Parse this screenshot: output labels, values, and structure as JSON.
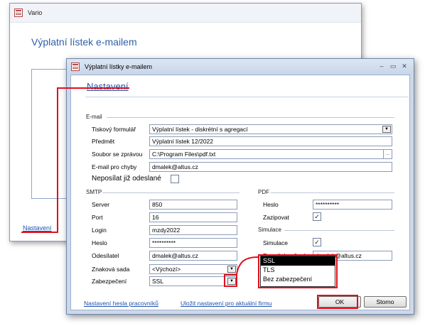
{
  "back_window": {
    "title": "Vario",
    "heading": "Výplatní lístek e-mailem",
    "link": "Nastavení"
  },
  "dialog": {
    "title": "Výplatní lístky e-mailem",
    "heading": "Nastavení",
    "email_section": "E-mail",
    "tiskovy_formular_label": "Tiskový formulář",
    "tiskovy_formular_value": "Výplatní lístek - diskrétní s agregací",
    "predmet_label": "Předmět",
    "predmet_value": "Výplatní lístek 12/2022",
    "soubor_label": "Soubor se zprávou",
    "soubor_value": "C:\\Program Files\\pdf.txt",
    "email_chyby_label": "E-mail pro chyby",
    "email_chyby_value": "dmalek@altus.cz",
    "neposilat_label": "Neposílat již odeslané",
    "smtp_section": "SMTP",
    "server_label": "Server",
    "server_value": "850",
    "port_label": "Port",
    "port_value": "16",
    "login_label": "Login",
    "login_value": "mzdy2022",
    "heslo_label": "Heslo",
    "heslo_value": "**********",
    "odesilatel_label": "Odesílatel",
    "odesilatel_value": "dmalek@altus.cz",
    "znakova_sada_label": "Znaková sada",
    "znakova_sada_value": "<Výchozí>",
    "zabezpeceni_label": "Zabezpečení",
    "zabezpeceni_value": "SSL",
    "pdf_section": "PDF",
    "pdf_heslo_label": "Heslo",
    "pdf_heslo_value": "**********",
    "zazipovat_label": "Zazipovat",
    "simulace_section": "Simulace",
    "simulace_label": "Simulace",
    "email_doruceni_label": "E-mail doručení",
    "email_doruceni_value": "dmalek@altus.cz",
    "dropdown_options": [
      "SSL",
      "TLS",
      "Bez zabezpečení"
    ],
    "footer_link_1": "Nastavení hesla pracovníků",
    "footer_link_2": "Uložit nastavení pro aktuální firmu",
    "ok_label": "OK",
    "storno_label": "Storno",
    "checkmark": "✓",
    "dots": "...",
    "caret": "▼",
    "minimize": "–",
    "maximize": "▭",
    "close": "✕"
  },
  "colors": {
    "accent": "#2a50a2",
    "annotation": "#e0101e",
    "dialog_frame": "#cdd9ea"
  }
}
